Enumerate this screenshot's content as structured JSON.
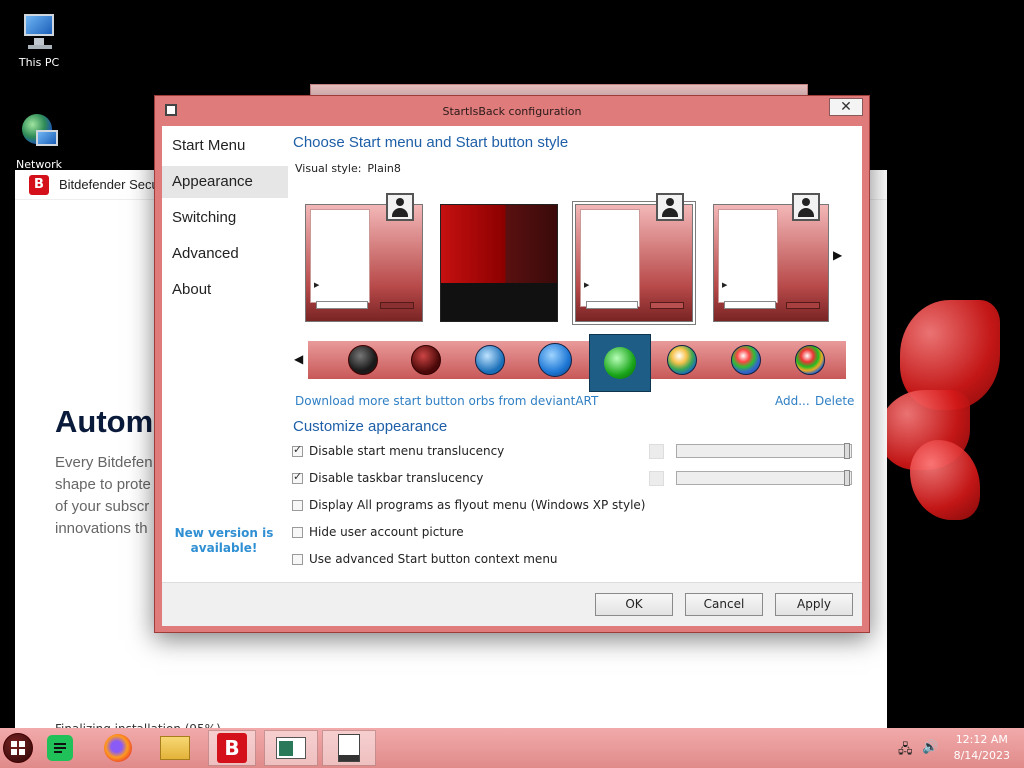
{
  "desktop": {
    "icons": [
      {
        "label": "This PC"
      },
      {
        "label": "Network"
      }
    ]
  },
  "bitdefender": {
    "title": "Bitdefender Secu",
    "heading": "Autom",
    "paragraph": [
      "Every Bitdefen",
      "shape to prote",
      "of your subscr",
      "innovations th"
    ],
    "status": "Finalizing installation (95%)"
  },
  "dialog": {
    "title": "StartIsBack configuration",
    "close_label": "✕",
    "nav": [
      {
        "label": "Start Menu"
      },
      {
        "label": "Appearance"
      },
      {
        "label": "Switching"
      },
      {
        "label": "Advanced"
      },
      {
        "label": "About"
      }
    ],
    "new_version": "New version is available!",
    "style_section_title": "Choose Start menu and Start button style",
    "visual_style_label": "Visual style:",
    "visual_style_value": "Plain8",
    "orbs_link": "Download more start button orbs from deviantART",
    "add_link": "Add...",
    "delete_link": "Delete",
    "customize_title": "Customize appearance",
    "options": [
      {
        "label": "Disable start menu translucency",
        "checked": true
      },
      {
        "label": "Disable taskbar translucency",
        "checked": true
      },
      {
        "label": "Display All programs as flyout menu (Windows XP style)",
        "checked": false
      },
      {
        "label": "Hide user account picture",
        "checked": false
      },
      {
        "label": "Use advanced Start button context menu",
        "checked": false
      }
    ],
    "buttons": {
      "ok": "OK",
      "cancel": "Cancel",
      "apply": "Apply"
    },
    "colors": {
      "accent": "#1e5fa8",
      "link": "#2f7fc4",
      "frame": "#e07b7b"
    }
  },
  "taskbar": {
    "icons": [
      "start-orb-icon",
      "spotify-icon",
      "firefox-icon",
      "file-explorer-icon",
      "bitdefender-icon",
      "window-app-icon",
      "document-app-icon"
    ],
    "time": "12:12 AM",
    "date": "8/14/2023"
  }
}
